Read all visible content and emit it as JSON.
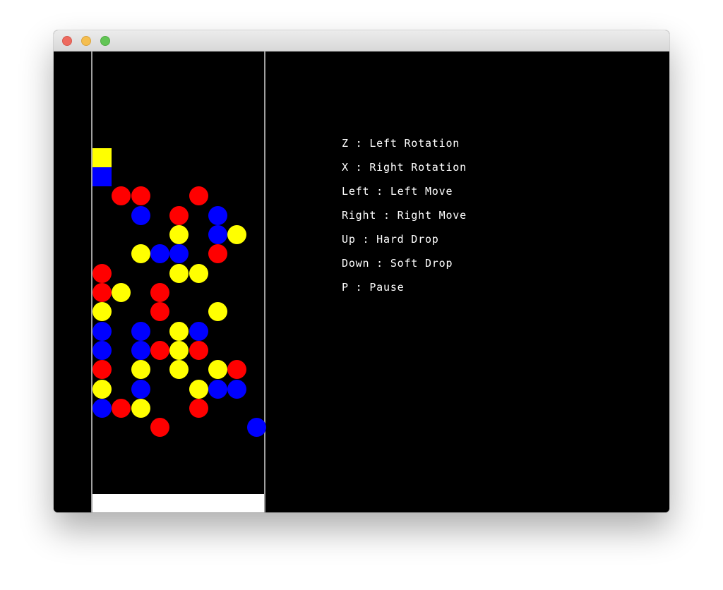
{
  "window": {
    "traffic_lights": [
      {
        "name": "close",
        "color": "#ee6a5f"
      },
      {
        "name": "minimize",
        "color": "#f5be4f"
      },
      {
        "name": "maximize",
        "color": "#62c555"
      }
    ]
  },
  "game": {
    "colors": {
      "red": "#ff0000",
      "blue": "#0000ff",
      "yellow": "#ffff00",
      "background": "#000000",
      "wall": "#a0a0a0",
      "floor": "#ffffff"
    },
    "board": {
      "columns": 9,
      "rows": 22,
      "falling_piece": [
        {
          "row": 5,
          "col": 0,
          "color": "yellow"
        },
        {
          "row": 6,
          "col": 0,
          "color": "blue"
        }
      ],
      "grid": [
        ".........",
        ".........",
        ".........",
        ".........",
        ".........",
        ".........",
        ".........",
        ".RR..R...",
        "..B.R.B..",
        "....Y.BY.",
        "..YBB.R..",
        "R...YY...",
        "RY.R.....",
        "Y..R..Y..",
        "B.B.YB...",
        "B.BRYR...",
        "R.Y.Y.YR.",
        "Y.B..YBB.",
        "BRY..R...",
        "...R....B",
        ".........",
        "........."
      ]
    }
  },
  "controls": [
    {
      "text": "Z : Left Rotation"
    },
    {
      "text": "X : Right Rotation"
    },
    {
      "text": "Left : Left Move"
    },
    {
      "text": "Right : Right Move"
    },
    {
      "text": "Up : Hard Drop"
    },
    {
      "text": "Down : Soft Drop"
    },
    {
      "text": "P : Pause"
    }
  ]
}
